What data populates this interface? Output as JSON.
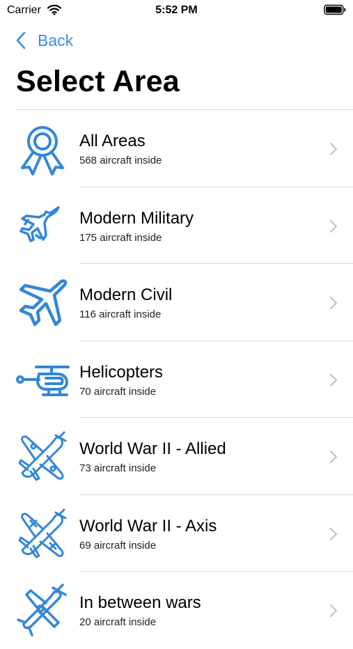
{
  "status_bar": {
    "carrier": "Carrier",
    "time": "5:52 PM"
  },
  "nav": {
    "back_label": "Back",
    "title": "Select Area"
  },
  "colors": {
    "accent": "#3a8ee6",
    "icon": "#3287d8",
    "chevron": "#c4c4c7",
    "divider": "#dcdcdc"
  },
  "areas": [
    {
      "title": "All Areas",
      "subtitle": "568 aircraft inside",
      "icon": "award-ribbon-icon"
    },
    {
      "title": "Modern Military",
      "subtitle": "175 aircraft inside",
      "icon": "fighter-jet-icon"
    },
    {
      "title": "Modern Civil",
      "subtitle": "116 aircraft inside",
      "icon": "airliner-icon"
    },
    {
      "title": "Helicopters",
      "subtitle": "70 aircraft inside",
      "icon": "helicopter-icon"
    },
    {
      "title": "World War II - Allied",
      "subtitle": "73 aircraft inside",
      "icon": "ww2-allied-plane-icon"
    },
    {
      "title": "World War II - Axis",
      "subtitle": "69 aircraft inside",
      "icon": "ww2-axis-plane-icon"
    },
    {
      "title": "In between wars",
      "subtitle": "20 aircraft inside",
      "icon": "biplane-icon"
    }
  ]
}
